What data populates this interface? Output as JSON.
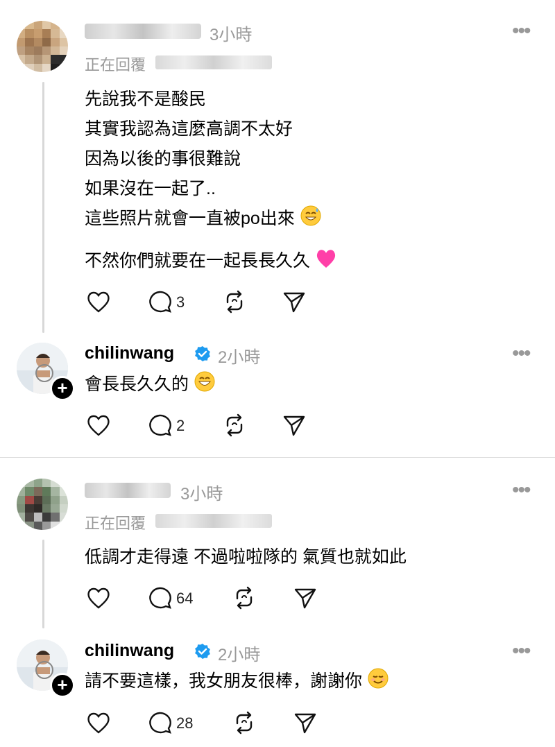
{
  "comments": [
    {
      "time": "3小時",
      "replying_label": "正在回覆",
      "lines": [
        "先說我不是酸民",
        "其實我認為這麼高調不太好",
        "因為以後的事很難說",
        "如果沒在一起了..",
        "這些照片就會一直被po出來"
      ],
      "last_line": "不然你們就要在一起長長久久",
      "reply_count": "3"
    },
    {
      "username": "chilinwang",
      "time": "2小時",
      "text": "會長長久久的",
      "reply_count": "2"
    },
    {
      "time": "3小時",
      "replying_label": "正在回覆",
      "text": "低調才走得遠 不過啦啦隊的 氣質也就如此",
      "reply_count": "64"
    },
    {
      "username": "chilinwang",
      "time": "2小時",
      "text": "請不要這樣，我女朋友很棒，謝謝你",
      "reply_count": "28"
    }
  ],
  "icons": [
    "heart-icon",
    "comment-icon",
    "repost-icon",
    "share-icon",
    "more-icon",
    "verified-badge-icon"
  ],
  "colors": {
    "verified": "#1d9bf0",
    "heart_emoji": "#ff3fa8",
    "muted": "#999999"
  }
}
